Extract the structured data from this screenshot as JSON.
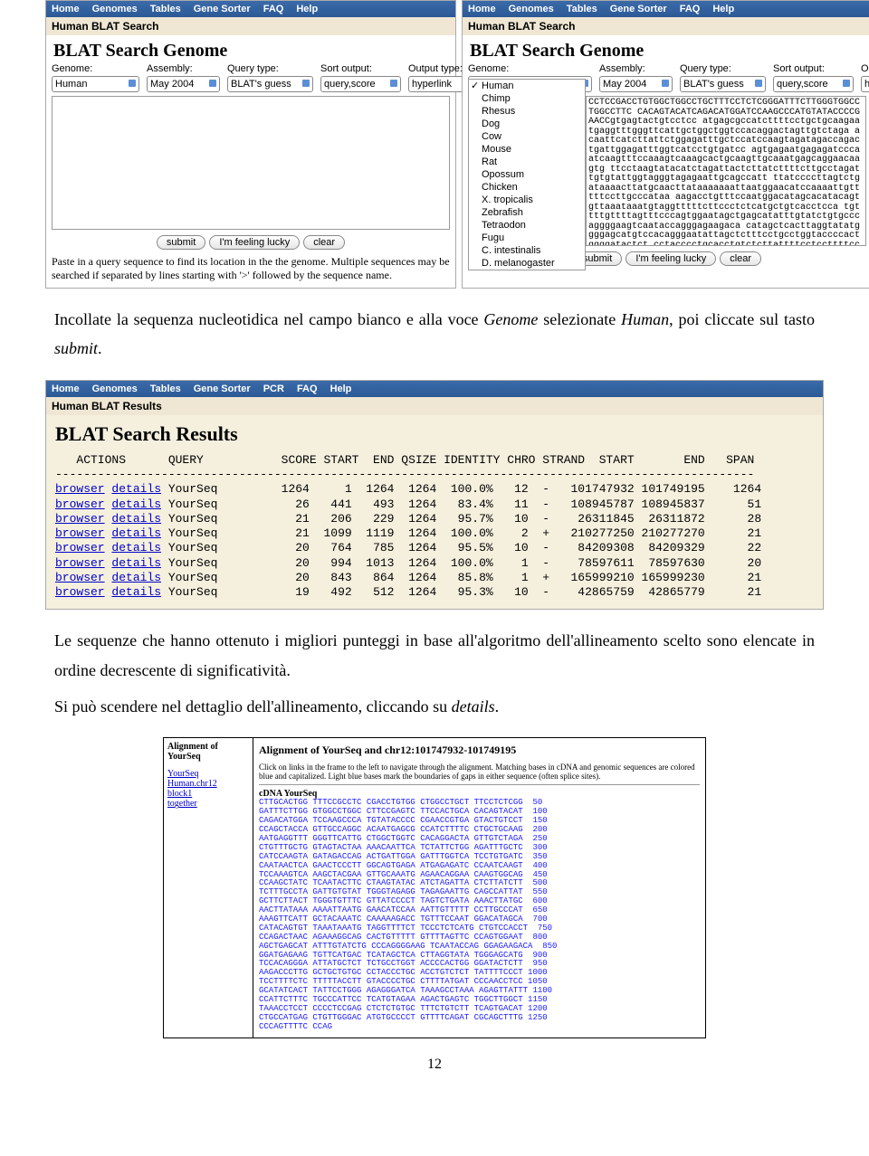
{
  "nav": {
    "home": "Home",
    "genomes": "Genomes",
    "tables": "Tables",
    "sorter": "Gene Sorter",
    "faq": "FAQ",
    "help": "Help",
    "pcr": "PCR"
  },
  "blat": {
    "subhead": "Human BLAT Search",
    "title": "BLAT Search Genome",
    "genome_lbl": "Genome:",
    "assembly_lbl": "Assembly:",
    "query_lbl": "Query type:",
    "sort_lbl": "Sort output:",
    "output_lbl": "Output type:",
    "genome_val": "Human",
    "assembly_val": "May 2004",
    "query_val": "BLAT's guess",
    "sort_val": "query,score",
    "output_val": "hyperlink",
    "submit": "submit",
    "lucky": "I'm feeling lucky",
    "clear": "clear",
    "tip": "Paste in a query sequence to find its location in the the genome. Multiple sequences may be searched if separated by lines starting with '>' followed by the sequence name."
  },
  "species": [
    "Human",
    "Chimp",
    "Rhesus",
    "Dog",
    "Cow",
    "Mouse",
    "Rat",
    "Opossum",
    "Chicken",
    "X. tropicalis",
    "Zebrafish",
    "Tetraodon",
    "Fugu",
    "C. intestinalis",
    "D. melanogaster"
  ],
  "seq_paste": "CCTCCGACCTGTGGCTGGCCTGCTTTCCTCTCGGGATTTCTTGGGTGGCCTGGCCTTC\nCACAGTACATCAGACATGGATCCAAGCCCATGTATACCCCGAACCgtgagtactgtcctcc\natgagcgccatcttttcctgctgcaagaatgaggtttgggttcattgctggctggtccacaggactagttgtctaga\nacaattcatcttattctggagatttgctccatccaagtagatagaccagactgattggagatttggtcatcctgtgatcc\nagtgagaatgagagatcccaatcaagtttccaaagtcaaagcactgcaagttgcaaatgagcaggaacaagtg\nttcctaagtatacatctagattactcttatcttttcttgcctagattgtgtattggtagggtagagaattgcagccatt\nttatccccttagtctgataaaacttatgcaacttataaaaaaattaatggaacatccaaaattgtttttccttgcccataa\naagacctgtttccaatggacatagcacatacagtgttaaataaatgtaggtttttcttccctctcatgctgtcacctcca\ntgttttgttttagtttcccagtggaatagctgagcatatttgtatctgtgcccaggggaagtcaataccagggagaagaca\ncatagctcacttaggtatatggggagcatgtccacagggaatattagctctttcctgcctggtaccccactggggatactct\ncctacccctgcacctgtctcttattttcctccttttcctttcctttttttaccttgtacccctgcctttatgatccaacctgtgcatat\ntcataaagccttaaaagagtattcatcttctttgccttcccatccttccatgtagaaagactgagtctggcttggcttaacct\ncttttctgtctttcagTGACATCTGCCATGAGCTGTTGGGACATGTGCCCCTTGTTTTCAGATCG\nTCCCAG",
  "para1": "Incollate la sequenza nucleotidica nel campo bianco e alla voce <em>Genome</em> selezionate <em>Human</em>, poi cliccate sul tasto <em>submit</em>.",
  "results": {
    "subhead": "Human BLAT Results",
    "title": "BLAT Search Results",
    "header": "   ACTIONS      QUERY           SCORE START  END QSIZE IDENTITY CHRO STRAND  START       END   SPAN",
    "dashes": "---------------------------------------------------------------------------------------------------",
    "rows": [
      {
        "q": "YourSeq",
        "score": "1264",
        "start": "1",
        "end": "1264",
        "qsize": "1264",
        "id": "100.0%",
        "chr": "12",
        "str": "-",
        "gs": "101747932",
        "ge": "101749195",
        "span": "1264"
      },
      {
        "q": "YourSeq",
        "score": "26",
        "start": "441",
        "end": "493",
        "qsize": "1264",
        "id": "83.4%",
        "chr": "11",
        "str": "-",
        "gs": "108945787",
        "ge": "108945837",
        "span": "51"
      },
      {
        "q": "YourSeq",
        "score": "21",
        "start": "206",
        "end": "229",
        "qsize": "1264",
        "id": "95.7%",
        "chr": "10",
        "str": "-",
        "gs": "26311845",
        "ge": "26311872",
        "span": "28"
      },
      {
        "q": "YourSeq",
        "score": "21",
        "start": "1099",
        "end": "1119",
        "qsize": "1264",
        "id": "100.0%",
        "chr": "2",
        "str": "+",
        "gs": "210277250",
        "ge": "210277270",
        "span": "21"
      },
      {
        "q": "YourSeq",
        "score": "20",
        "start": "764",
        "end": "785",
        "qsize": "1264",
        "id": "95.5%",
        "chr": "10",
        "str": "-",
        "gs": "84209308",
        "ge": "84209329",
        "span": "22"
      },
      {
        "q": "YourSeq",
        "score": "20",
        "start": "994",
        "end": "1013",
        "qsize": "1264",
        "id": "100.0%",
        "chr": "1",
        "str": "-",
        "gs": "78597611",
        "ge": "78597630",
        "span": "20"
      },
      {
        "q": "YourSeq",
        "score": "20",
        "start": "843",
        "end": "864",
        "qsize": "1264",
        "id": "85.8%",
        "chr": "1",
        "str": "+",
        "gs": "165999210",
        "ge": "165999230",
        "span": "21"
      },
      {
        "q": "YourSeq",
        "score": "19",
        "start": "492",
        "end": "512",
        "qsize": "1264",
        "id": "95.3%",
        "chr": "10",
        "str": "-",
        "gs": "42865759",
        "ge": "42865779",
        "span": "21"
      }
    ]
  },
  "para2": "Le sequenze che hanno ottenuto i migliori punteggi in base all'algoritmo dell'allineamento scelto sono elencate in ordine decrescente di significatività.",
  "para3": "Si può scendere nel dettaglio dell'allineamento, cliccando su <em>details</em>.",
  "align": {
    "left_title": "Alignment of YourSeq",
    "links": [
      "YourSeq",
      "Human.chr12",
      "block1",
      "together"
    ],
    "head": "Alignment of YourSeq and chr12:101747932-101749195",
    "note": "Click on links in the frame to the left to navigate through the alignment. Matching bases in cDNA and genomic sequences are colored blue and capitalized. Light blue bases mark the boundaries of gaps in either sequence (often splice sites).",
    "cdna_lbl": "cDNA YourSeq",
    "cdna": "CTTGCACTGG TTTCCGCCTC CGACCTGTGG CTGGCCTGCT TTCCTCTCGG  50\nGATTTCTTGG GTGGCCTGGC CTTCCGAGTC TTCCACTGCA CACAGTACAT  100\nCAGACATGGA TCCAAGCCCA TGTATACCCC CGAACCGTGA GTACTGTCCT  150\nCCAGCTACCA GTTGCCAGGC ACAATGAGCG CCATCTTTTC CTGCTGCAAG  200\nAATGAGGTTT GGGTTCATTG CTGGCTGGTC CACAGGACTA GTTGTCTAGA  250\nCTGTTTGCTG GTAGTACTAA AAACAATTCA TCTATTCTGG AGATTTGCTC  300\nCATCCAAGTA GATAGACCAG ACTGATTGGA GATTTGGTCA TCCTGTGATC  350\nCAATAACTCA GAACTCCCTT GGCAGTGAGA ATGAGAGATC CCAATCAAGT  400\nTCCAAAGTCA AAGCTACGAA GTTGCAAATG AGAACAGGAA CAAGTGGCAG  450\nCCAAGCTATC TCAATACTTC CTAAGTATAC ATCTAGATTA CTCTTATCTT  500\nTCTTTGCCTA GATTGTGTAT TGGGTAGAGG TAGAGAATTG CAGCCATTAT  550\nGCTTCTTACT TGGGTGTTTC GTTATCCCCT TAGTCTGATA AAACTTATGC  600\nAACTTATAAA AAAATTAATG GAACATCCAA AATTGTTTTT CCTTGCCCAT  650\nAAAGTTCATT GCTACAAATC CAAAAAGACC TGTTTCCAAT GGACATAGCA  700\nCATACAGTGT TAAATAAATG TAGGTTTTCT TCCCTCTCATG CTGTCCACCT  750\nCCAGACTAAC AGAAAGGCAG CACTGTTTTT GTTTTAGTTC CCAGTGGAAT  800\nAGCTGAGCAT ATTTGTATCTG CCCAGGGGAAG TCAATACCAG GGAGAAGACA  850\nGGATGAGAAG TGTTCATGAC TCATAGCTCA CTTAGGTATA TGGGAGCATG  900\nTCCACAGGGA ATTATGCTCT TCTGCCTGGT ACCCCACTGG GGATACTCTT  950\nAAGACCCTTG GCTGCTGTGC CCTACCCTGC ACCTGTCTCT TATTTTCCCT 1000\nTCCTTTTCTC TTTTTACCTT GTACCCCTGC CTTTTATGAT CCCAACCTCC 1050\nGCATATCACT TATTCCTGGG AGAGGGATCA TAAAGCCTAAA AGAGTTATTT 1100\nCCATTCTTTC TGCCCATTCC TCATGTAGAA AGACTGAGTC TGGCTTGGCT 1150\nTAAACCTCCT CCCCTCCGAG CTCTCTGTGC TTTCTGTCTT TCAGTGACAT 1200\nCTGCCATGAG CTGTTGGGAC ATGTGCCCCT GTTTTCAGAT CGCAGCTTTG 1250\nCCCAGTTTTC CCAG"
  },
  "pagenum": "12"
}
